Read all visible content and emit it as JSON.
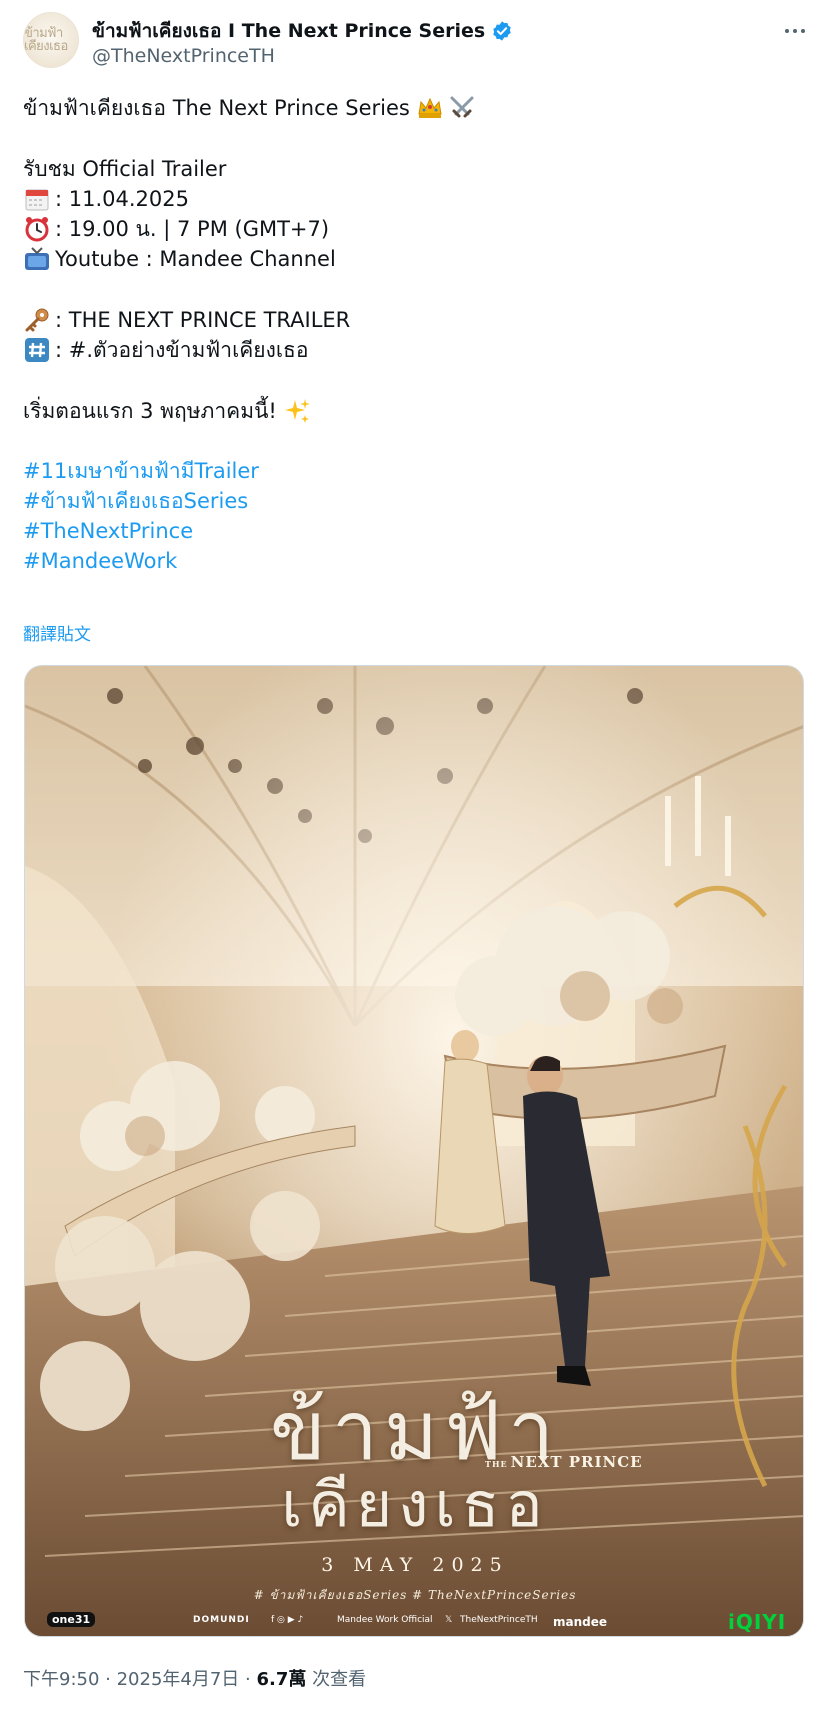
{
  "author": {
    "display_name": "ข้ามฟ้าเคียงเธอ I The Next Prince Series",
    "handle": "@TheNextPrinceTH",
    "avatar_text": "ข้ามฟ้า เคียงเธอ"
  },
  "tweet": {
    "line_title": "ข้ามฟ้าเคียงเธอ The Next Prince Series",
    "title_emojis": [
      "crown-icon",
      "crossed-swords-icon"
    ],
    "line_watch": "รับชม Official Trailer",
    "line_date": " : 11.04.2025",
    "line_time": ": 19.00 น. | 7 PM (GMT+7)",
    "line_channel": " Youtube : Mandee Channel",
    "line_key": " : THE NEXT PRINCE TRAILER",
    "line_hash": " : #.ตัวอย่างข้ามฟ้าเคียงเธอ",
    "line_start": "เริ่มตอนแรก 3 พฤษภาคมนี้! ",
    "hashtags": [
      "#11เมษาข้ามฟ้ามีTrailer",
      "#ข้ามฟ้าเคียงเธอSeries",
      "#TheNextPrince",
      "#MandeeWork"
    ],
    "translate_label": "翻譯貼文"
  },
  "poster": {
    "title_line1": "ข้ามฟ้า",
    "title_line2": "เคียงเธอ",
    "subtitle_small": "THE",
    "subtitle": "NEXT PRINCE",
    "date": "3 MAY 2025",
    "tags": "# ข้ามฟ้าเคียงเธอSeries   # TheNextPrinceSeries",
    "footer": {
      "channel_logo": "one31",
      "domundi": "DOMUNDI",
      "social_handle": "Mandee Work Official",
      "x_handle": "TheNextPrinceTH",
      "mandee_logo": "mandee",
      "iqiyi_logo": "iQIYI"
    }
  },
  "meta": {
    "time": "下午9:50 · 2025年4月7日 · ",
    "views": "6.7萬",
    "views_label": " 次查看"
  },
  "colors": {
    "link": "#1d9bf0",
    "secondary": "#536471",
    "verified": "#1d9bf0"
  }
}
